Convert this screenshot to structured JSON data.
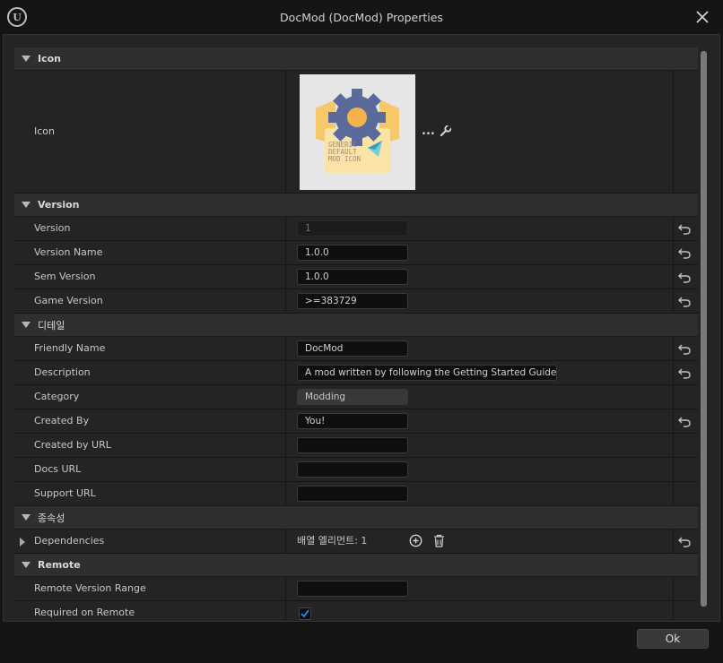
{
  "window": {
    "title": "DocMod (DocMod) Properties"
  },
  "sections": {
    "icon": {
      "title": "Icon",
      "icon_label": "Icon",
      "thumb_text": [
        "GENERIC",
        "DEFAULT",
        "MOD ICON"
      ],
      "more": "..."
    },
    "version": {
      "title": "Version",
      "rows": [
        {
          "label": "Version",
          "value": "1"
        },
        {
          "label": "Version Name",
          "value": "1.0.0"
        },
        {
          "label": "Sem Version",
          "value": "1.0.0"
        },
        {
          "label": "Game Version",
          "value": ">=383729"
        }
      ]
    },
    "details": {
      "title": "디테일",
      "rows": [
        {
          "label": "Friendly Name",
          "value": "DocMod"
        },
        {
          "label": "Description",
          "value": "A mod written by following the Getting Started Guide."
        },
        {
          "label": "Category",
          "value": "Modding"
        },
        {
          "label": "Created By",
          "value": "You!"
        },
        {
          "label": "Created by URL",
          "value": ""
        },
        {
          "label": "Docs URL",
          "value": ""
        },
        {
          "label": "Support URL",
          "value": ""
        }
      ]
    },
    "dependencies": {
      "title": "종속성",
      "rows": [
        {
          "label": "Dependencies",
          "value": "배열 엘리먼트: 1"
        }
      ]
    },
    "remote": {
      "title": "Remote",
      "rows": [
        {
          "label": "Remote Version Range",
          "value": ""
        },
        {
          "label": "Required on Remote",
          "checked": true
        }
      ]
    }
  },
  "footer": {
    "ok_label": "Ok"
  },
  "colors": {
    "accent": "#1e8fff",
    "background": "#242424",
    "section": "#2f2f2f"
  }
}
